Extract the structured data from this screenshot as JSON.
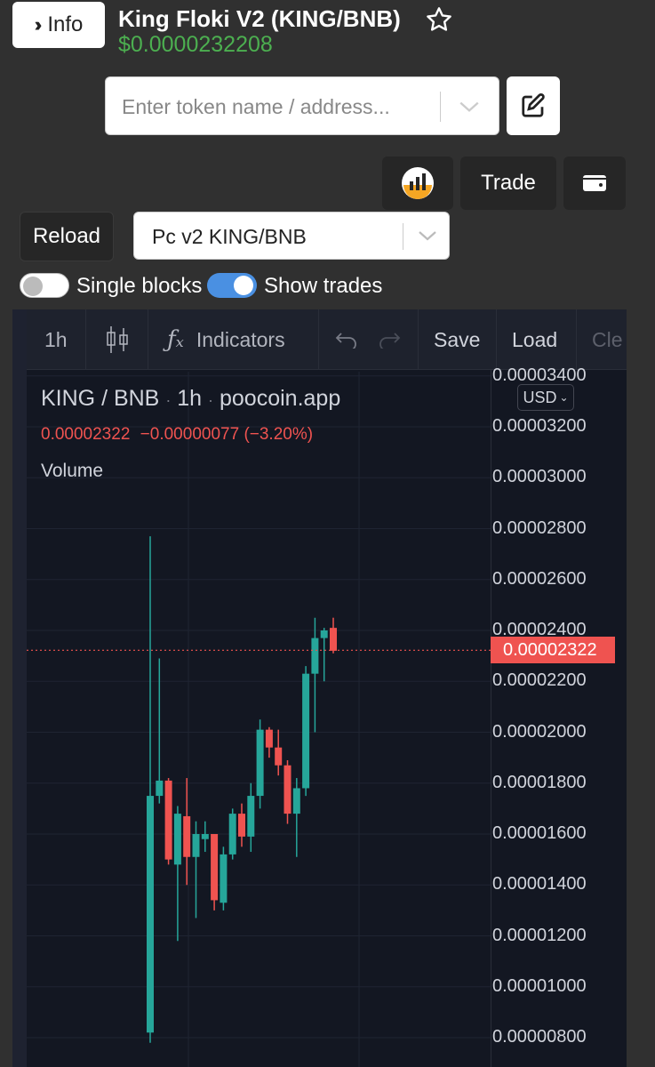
{
  "header": {
    "info_label": "Info",
    "token_title": "King Floki V2 (KING/BNB)",
    "token_price": "$0.0000232208"
  },
  "search": {
    "placeholder": "Enter token name / address..."
  },
  "actions": {
    "trade_label": "Trade",
    "reload_label": "Reload"
  },
  "pair_select": {
    "value": "Pc v2 KING/BNB"
  },
  "toggles": {
    "single_blocks": {
      "label": "Single blocks",
      "on": false
    },
    "show_trades": {
      "label": "Show trades",
      "on": true
    }
  },
  "chart_toolbar": {
    "interval": "1h",
    "indicators": "Indicators",
    "save": "Save",
    "load": "Load",
    "clear": "Cle"
  },
  "chart_legend": {
    "pair": "KING / BNB",
    "interval": "1h",
    "source": "poocoin.app",
    "sep": "·",
    "last": "0.00002322",
    "change": "−0.00000077",
    "change_pct": "(−3.20%)",
    "volume_label": "Volume",
    "currency": "USD"
  },
  "colors": {
    "up": "#26a69a",
    "down": "#ef5350",
    "price_green": "#4caf50"
  },
  "chart_data": {
    "type": "candlestick",
    "current_price": 2.322e-05,
    "current_price_label": "0.00002322",
    "ylim": [
      7.5e-06,
      3.42e-05
    ],
    "y_ticks": [
      "0.00000800",
      "0.00001000",
      "0.00001200",
      "0.00001400",
      "0.00001600",
      "0.00001800",
      "0.00002000",
      "0.00002200",
      "0.00002400",
      "0.00002600",
      "0.00002800",
      "0.00003000",
      "0.00003200",
      "0.00003400"
    ],
    "candles": [
      {
        "o": 8.2e-06,
        "h": 2.77e-05,
        "l": 7.8e-06,
        "c": 1.75e-05
      },
      {
        "o": 1.75e-05,
        "h": 2.29e-05,
        "l": 1.72e-05,
        "c": 1.81e-05
      },
      {
        "o": 1.81e-05,
        "h": 1.82e-05,
        "l": 1.48e-05,
        "c": 1.5e-05
      },
      {
        "o": 1.48e-05,
        "h": 1.71e-05,
        "l": 1.18e-05,
        "c": 1.68e-05
      },
      {
        "o": 1.67e-05,
        "h": 1.82e-05,
        "l": 1.4e-05,
        "c": 1.51e-05
      },
      {
        "o": 1.51e-05,
        "h": 1.65e-05,
        "l": 1.27e-05,
        "c": 1.6e-05
      },
      {
        "o": 1.58e-05,
        "h": 1.65e-05,
        "l": 1.53e-05,
        "c": 1.6e-05
      },
      {
        "o": 1.6e-05,
        "h": 1.6e-05,
        "l": 1.3e-05,
        "c": 1.34e-05
      },
      {
        "o": 1.33e-05,
        "h": 1.55e-05,
        "l": 1.3e-05,
        "c": 1.52e-05
      },
      {
        "o": 1.52e-05,
        "h": 1.7e-05,
        "l": 1.5e-05,
        "c": 1.68e-05
      },
      {
        "o": 1.68e-05,
        "h": 1.72e-05,
        "l": 1.55e-05,
        "c": 1.59e-05
      },
      {
        "o": 1.59e-05,
        "h": 1.8e-05,
        "l": 1.53e-05,
        "c": 1.75e-05
      },
      {
        "o": 1.75e-05,
        "h": 2.05e-05,
        "l": 1.7e-05,
        "c": 2.01e-05
      },
      {
        "o": 2.01e-05,
        "h": 2.02e-05,
        "l": 1.9e-05,
        "c": 1.94e-05
      },
      {
        "o": 1.94e-05,
        "h": 2.01e-05,
        "l": 1.83e-05,
        "c": 1.87e-05
      },
      {
        "o": 1.87e-05,
        "h": 1.89e-05,
        "l": 1.64e-05,
        "c": 1.68e-05
      },
      {
        "o": 1.68e-05,
        "h": 1.82e-05,
        "l": 1.51e-05,
        "c": 1.78e-05
      },
      {
        "o": 1.78e-05,
        "h": 2.26e-05,
        "l": 1.75e-05,
        "c": 2.23e-05
      },
      {
        "o": 2.23e-05,
        "h": 2.45e-05,
        "l": 2e-05,
        "c": 2.37e-05
      },
      {
        "o": 2.37e-05,
        "h": 2.41e-05,
        "l": 2.2e-05,
        "c": 2.4e-05
      },
      {
        "o": 2.41e-05,
        "h": 2.45e-05,
        "l": 2.31e-05,
        "c": 2.32e-05
      }
    ]
  }
}
